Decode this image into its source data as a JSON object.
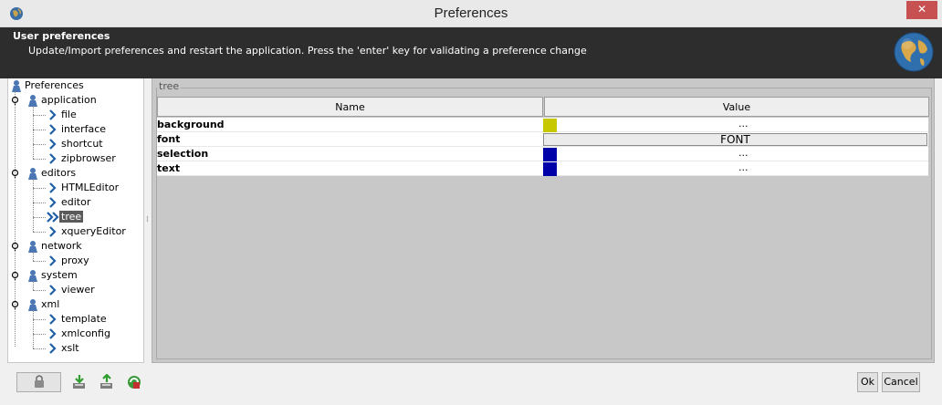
{
  "window": {
    "title": "Preferences"
  },
  "header": {
    "title": "User preferences",
    "description": "Update/Import preferences and restart the application. Press the 'enter' key for validating a preference change"
  },
  "tree": {
    "root": "Preferences",
    "groups": [
      {
        "label": "application",
        "children": [
          "file",
          "interface",
          "shortcut",
          "zipbrowser"
        ]
      },
      {
        "label": "editors",
        "children": [
          "HTMLEditor",
          "editor",
          "tree",
          "xqueryEditor"
        ]
      },
      {
        "label": "network",
        "children": [
          "proxy"
        ]
      },
      {
        "label": "system",
        "children": [
          "viewer"
        ]
      },
      {
        "label": "xml",
        "children": [
          "template",
          "xmlconfig",
          "xslt"
        ]
      }
    ],
    "selected": "tree"
  },
  "section": {
    "title": "tree"
  },
  "table": {
    "columns": [
      "Name",
      "Value"
    ],
    "rows": [
      {
        "name": "background",
        "value_type": "color",
        "color": "#c8c800",
        "dots": "..."
      },
      {
        "name": "font",
        "value_type": "font",
        "value": "FONT"
      },
      {
        "name": "selection",
        "value_type": "color",
        "color": "#0000a8",
        "dots": "..."
      },
      {
        "name": "text",
        "value_type": "color",
        "color": "#0000a8",
        "dots": "..."
      }
    ]
  },
  "buttons": {
    "ok": "Ok",
    "cancel": "Cancel"
  },
  "icons": {
    "app": "globe-small-icon",
    "header": "globe-icon",
    "lock": "lock-icon",
    "import": "import-icon",
    "export": "export-icon",
    "reset": "reset-icon",
    "close": "close-icon"
  },
  "colors": {
    "header_bg": "#2d2d2d",
    "close_bg": "#c75050",
    "panel_bg": "#c8c8c8",
    "selected_bg": "#5a5a5a"
  }
}
